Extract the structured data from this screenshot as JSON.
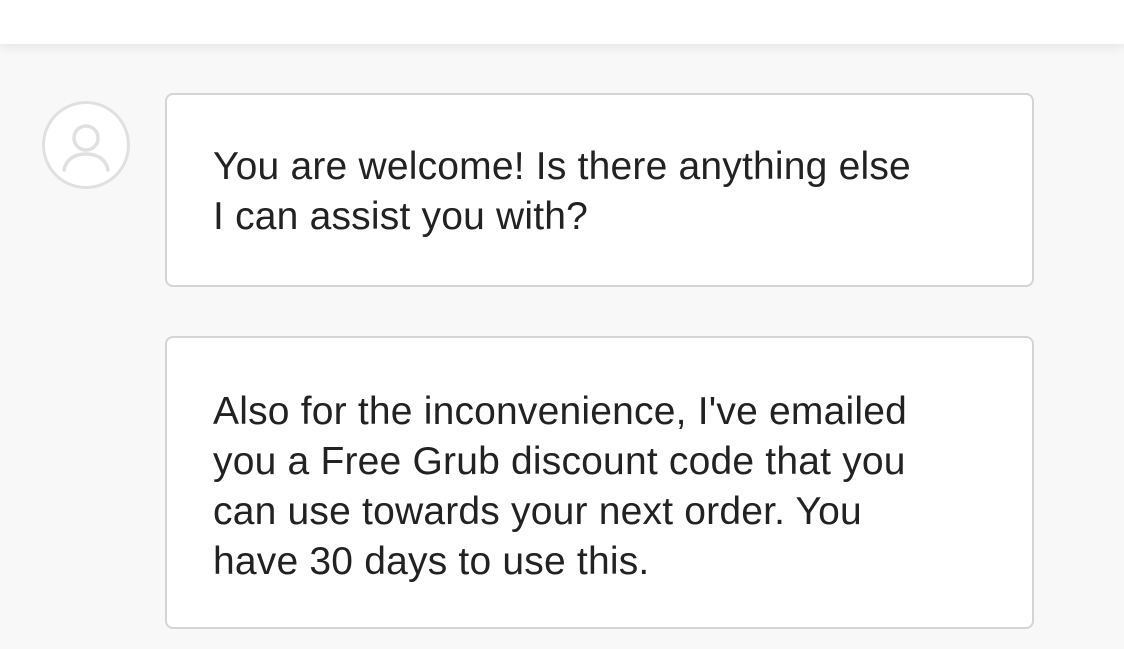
{
  "header": {},
  "chat": {
    "avatar_icon": "user-icon",
    "messages": [
      {
        "lines": [
          "You are welcome! Is there anything else",
          "I can assist you with?"
        ]
      },
      {
        "lines": [
          "Also for the inconvenience, I've emailed",
          "you a Free Grub discount code that you",
          "can use towards your next order. You",
          "have 30 days to use this."
        ]
      }
    ]
  }
}
